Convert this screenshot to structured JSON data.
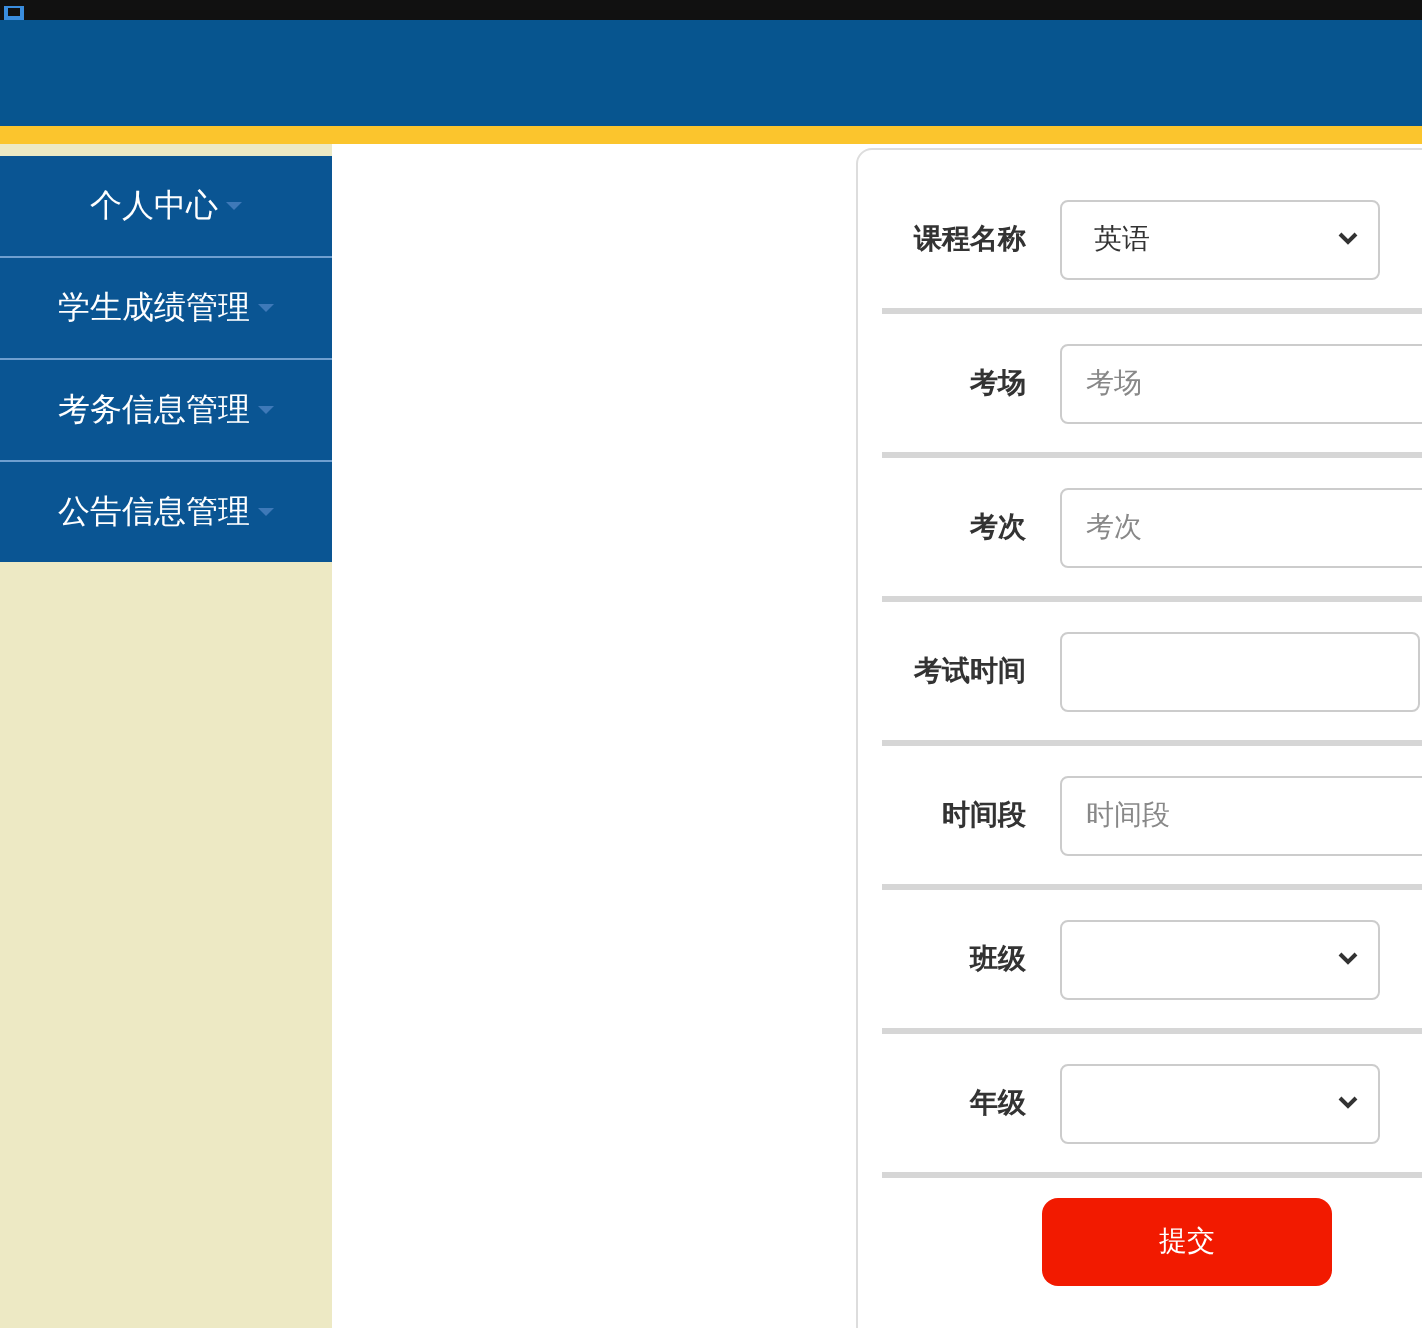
{
  "sidebar": {
    "items": [
      {
        "label": "个人中心"
      },
      {
        "label": "学生成绩管理"
      },
      {
        "label": "考务信息管理"
      },
      {
        "label": "公告信息管理"
      }
    ]
  },
  "form": {
    "fields": [
      {
        "label": "课程名称",
        "kind": "select",
        "value": "英语"
      },
      {
        "label": "考场",
        "kind": "text",
        "placeholder": "考场"
      },
      {
        "label": "考次",
        "kind": "text",
        "placeholder": "考次"
      },
      {
        "label": "考试时间",
        "kind": "date"
      },
      {
        "label": "时间段",
        "kind": "text",
        "placeholder": "时间段"
      },
      {
        "label": "班级",
        "kind": "select"
      },
      {
        "label": "年级",
        "kind": "select"
      }
    ],
    "submit": "提交"
  }
}
